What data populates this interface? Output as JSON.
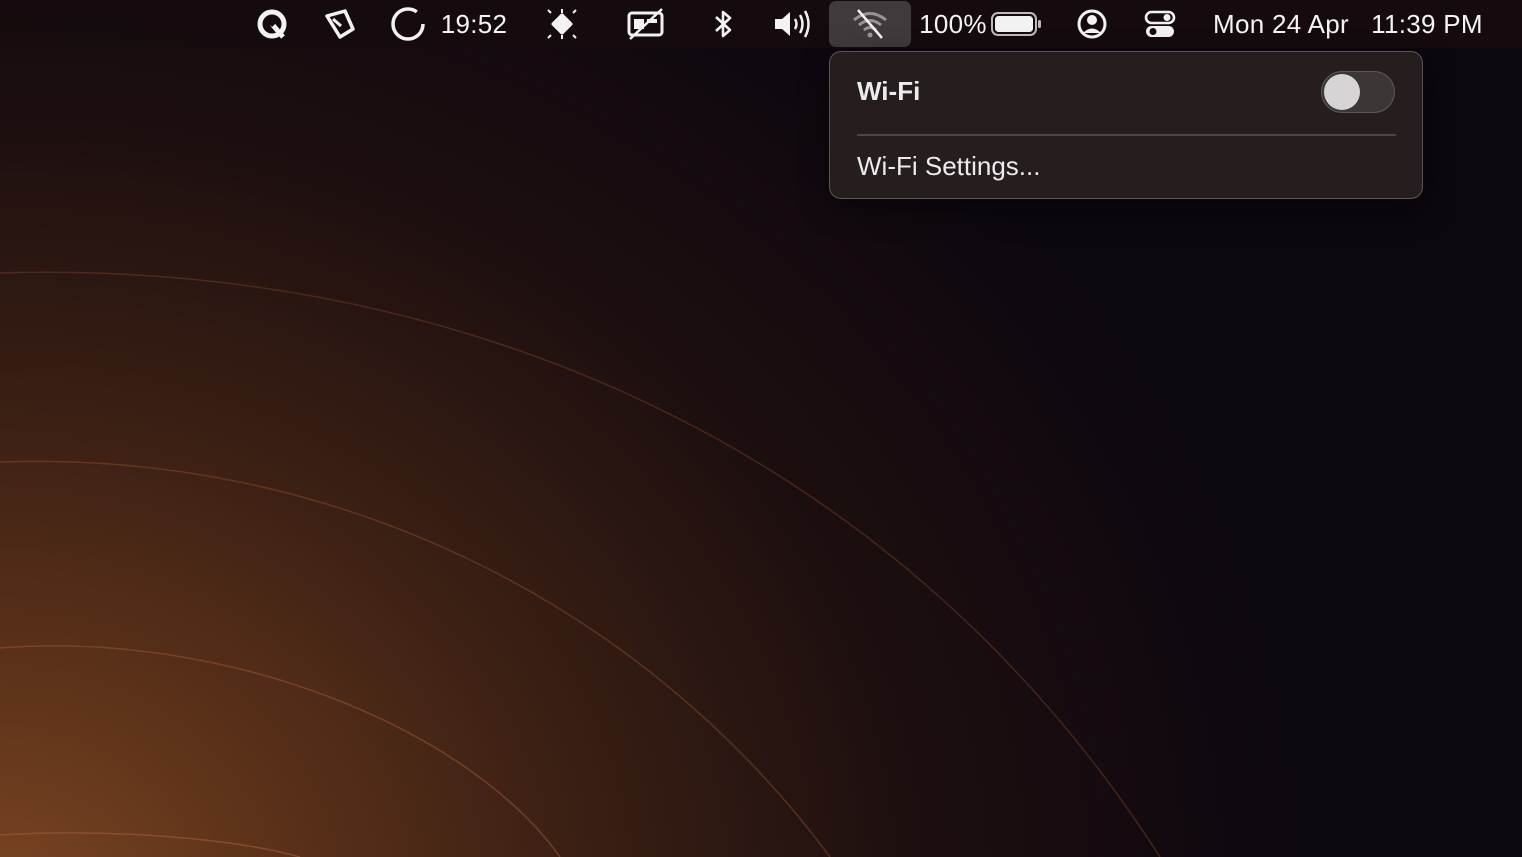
{
  "menubar": {
    "timer_text": "19:52",
    "battery_percent": "100%",
    "battery_level": 1.0,
    "date": "Mon 24 Apr",
    "time": "11:39 PM",
    "icons": [
      "quick-refresh-icon",
      "pen-tool-icon",
      "timer-ring-icon",
      "cpu-chip-icon",
      "display-off-icon",
      "bluetooth-icon",
      "volume-icon",
      "wifi-off-icon",
      "battery-icon",
      "user-account-icon",
      "control-center-icon"
    ]
  },
  "wifi_menu": {
    "title": "Wi-Fi",
    "toggle_on": false,
    "settings_label": "Wi-Fi Settings..."
  },
  "colors": {
    "menubar_bg": "#160c0e",
    "menu_bg": "#261e1f",
    "text": "#ececec",
    "toggle_off": "#3d3637",
    "knob": "#d6d4d4"
  }
}
